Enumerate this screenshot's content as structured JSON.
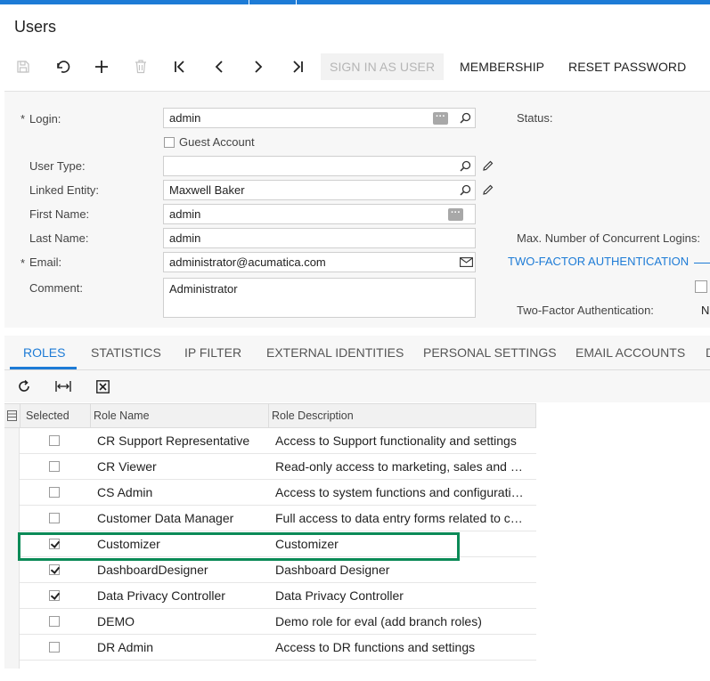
{
  "page": {
    "title": "Users"
  },
  "toolbar": {
    "sign_in_as_user": "SIGN IN AS USER",
    "membership": "MEMBERSHIP",
    "reset_password": "RESET PASSWORD",
    "icons": [
      "save-icon",
      "undo-icon",
      "add-icon",
      "delete-icon",
      "first-record-icon",
      "previous-record-icon",
      "next-record-icon",
      "last-record-icon"
    ]
  },
  "form": {
    "login": {
      "label": "Login:",
      "value": "admin"
    },
    "guest_account": {
      "label": "Guest Account",
      "checked": false
    },
    "user_type": {
      "label": "User Type:",
      "value": ""
    },
    "linked_entity": {
      "label": "Linked Entity:",
      "value": "Maxwell Baker"
    },
    "first_name": {
      "label": "First Name:",
      "value": "admin"
    },
    "last_name": {
      "label": "Last Name:",
      "value": "admin"
    },
    "email": {
      "label": "Email:",
      "value": "administrator@acumatica.com"
    },
    "comment": {
      "label": "Comment:",
      "value": "Administrator"
    },
    "status": {
      "label": "Status:"
    },
    "max_logins": {
      "label": "Max. Number of Concurrent Logins:"
    },
    "two_factor_section": {
      "label": "TWO-FACTOR AUTHENTICATION"
    },
    "two_factor": {
      "label": "Two-Factor Authentication:",
      "value": "N"
    }
  },
  "tabs": [
    "ROLES",
    "STATISTICS",
    "IP FILTER",
    "EXTERNAL IDENTITIES",
    "PERSONAL SETTINGS",
    "EMAIL ACCOUNTS",
    "D"
  ],
  "active_tab": "ROLES",
  "grid": {
    "columns": [
      "Selected",
      "Role Name",
      "Role Description"
    ],
    "rows": [
      {
        "selected": false,
        "name": "CR Support Representative",
        "description": "Access to Support functionality and settings"
      },
      {
        "selected": false,
        "name": "CR Viewer",
        "description": "Read-only access to marketing, sales and sup..."
      },
      {
        "selected": false,
        "name": "CS Admin",
        "description": "Access to system functions and configuration i..."
      },
      {
        "selected": false,
        "name": "Customer Data Manager",
        "description": "Full access to data entry forms related to custo..."
      },
      {
        "selected": true,
        "name": "Customizer",
        "description": "Customizer"
      },
      {
        "selected": true,
        "name": "DashboardDesigner",
        "description": "Dashboard Designer"
      },
      {
        "selected": true,
        "name": "Data Privacy Controller",
        "description": "Data Privacy Controller"
      },
      {
        "selected": false,
        "name": "DEMO",
        "description": "Demo role for eval (add branch roles)"
      },
      {
        "selected": false,
        "name": "DR Admin",
        "description": "Access to DR functions and settings"
      }
    ]
  },
  "colors": {
    "accent": "#1d7bd6",
    "highlight": "#0b8a57"
  }
}
